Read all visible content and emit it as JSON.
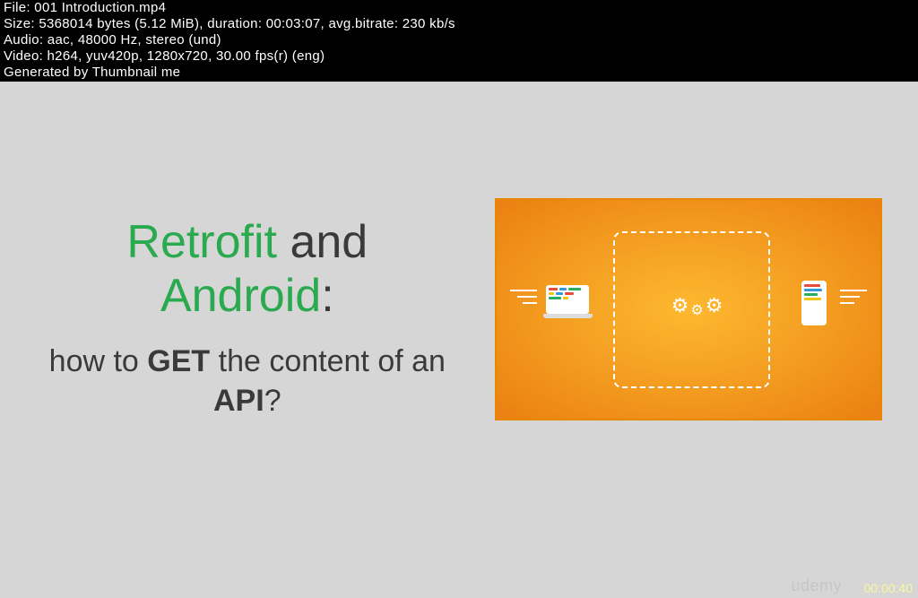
{
  "metadata": {
    "file_line": "File: 001 Introduction.mp4",
    "size_line": "Size: 5368014 bytes (5.12 MiB), duration: 00:03:07, avg.bitrate: 230 kb/s",
    "audio_line": "Audio: aac, 48000 Hz, stereo (und)",
    "video_line": "Video: h264, yuv420p, 1280x720, 30.00 fps(r) (eng)",
    "generated_line": "Generated by Thumbnail me"
  },
  "slide": {
    "title_word1": "Retrofit",
    "title_word2": " and ",
    "title_word3": "Android",
    "title_colon": ":",
    "subtitle_part1": "how to ",
    "subtitle_bold1": "GET",
    "subtitle_part2": " the content of an ",
    "subtitle_bold2": "API",
    "subtitle_part3": "?"
  },
  "footer": {
    "watermark": "udemy",
    "timestamp": "00:00:40"
  }
}
